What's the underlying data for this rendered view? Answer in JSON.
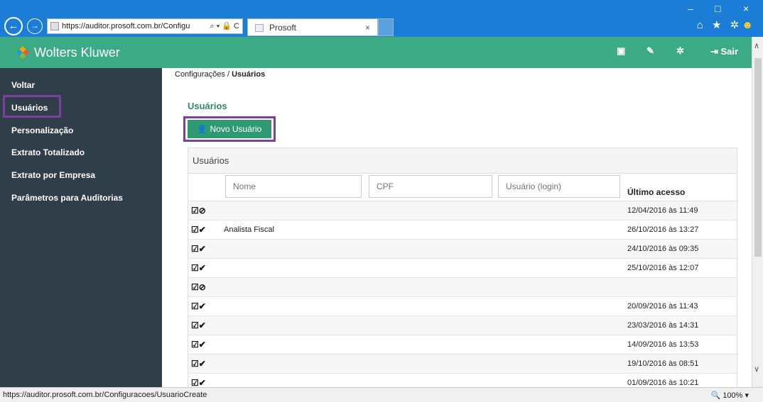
{
  "browser": {
    "url": "https://auditor.prosoft.com.br/Configu",
    "tab_title": "Prosoft",
    "tab_close": "×",
    "win_minimize": "–",
    "win_restore": "□",
    "win_close": "×",
    "addr_icons": "⌕ ▾ 🔒 C",
    "tool_icons": "⌂ ★ ✲",
    "smile": "☻"
  },
  "header": {
    "brand": "Wolters Kluwer",
    "logout_label": "Sair",
    "icons": [
      "book-icon",
      "wrench-icon",
      "gears-icon",
      "logout-icon"
    ]
  },
  "sidebar": {
    "items": [
      {
        "label": "Voltar"
      },
      {
        "label": "Usuários"
      },
      {
        "label": "Personalização"
      },
      {
        "label": "Extrato Totalizado"
      },
      {
        "label": "Extrato por Empresa"
      },
      {
        "label": "Parâmetros para Auditorias"
      }
    ]
  },
  "main": {
    "breadcrumb_parent": "Configurações / ",
    "breadcrumb_current": "Usuários",
    "section_title": "Usuários",
    "new_user_label": "Novo Usuário",
    "panel_title": "Usuários",
    "filters": {
      "nome": "Nome",
      "cpf": "CPF",
      "usuario": "Usuário (login)"
    },
    "col_last_access": "Último acesso",
    "rows": [
      {
        "status": "blocked",
        "nome": "",
        "acesso": "12/04/2016 às 11:49"
      },
      {
        "status": "active",
        "nome": "Analista Fiscal",
        "acesso": "26/10/2016 às 13:27"
      },
      {
        "status": "active",
        "nome": "",
        "acesso": "24/10/2016 às 09:35"
      },
      {
        "status": "active",
        "nome": "",
        "acesso": "25/10/2016 às 12:07"
      },
      {
        "status": "blocked",
        "nome": "",
        "acesso": ""
      },
      {
        "status": "active",
        "nome": "",
        "acesso": "20/09/2016 às 11:43"
      },
      {
        "status": "active",
        "nome": "",
        "acesso": "23/03/2016 às 14:31"
      },
      {
        "status": "active",
        "nome": "",
        "acesso": "14/09/2016 às 13:53"
      },
      {
        "status": "active",
        "nome": "",
        "acesso": "19/10/2016 às 08:51"
      },
      {
        "status": "active",
        "nome": "",
        "acesso": "01/09/2016 às 10:21"
      }
    ]
  },
  "statusbar": {
    "url": "https://auditor.prosoft.com.br/Configuracoes/UsuarioCreate",
    "zoom": "100%"
  },
  "colors": {
    "header_green": "#3caa84",
    "sidebar_dark": "#2f3e49",
    "highlight_purple": "#7b3fa0",
    "browser_blue": "#1c7dd6"
  }
}
